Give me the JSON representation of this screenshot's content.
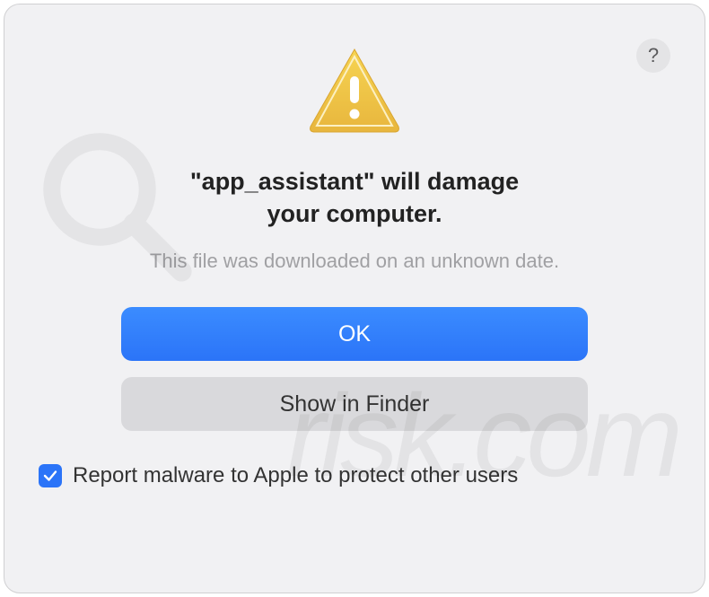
{
  "dialog": {
    "help_label": "?",
    "title_line1": "\"app_assistant\" will damage",
    "title_line2": "your computer.",
    "subtitle": "This file was downloaded on an unknown date.",
    "ok_label": "OK",
    "show_in_finder_label": "Show in Finder",
    "checkbox_checked": true,
    "checkbox_label": "Report malware to Apple to protect other users"
  },
  "watermark": {
    "text": "risk.com"
  },
  "colors": {
    "primary": "#2b74f8",
    "secondary_bg": "#d9d9dc",
    "dialog_bg": "#f1f1f3"
  }
}
